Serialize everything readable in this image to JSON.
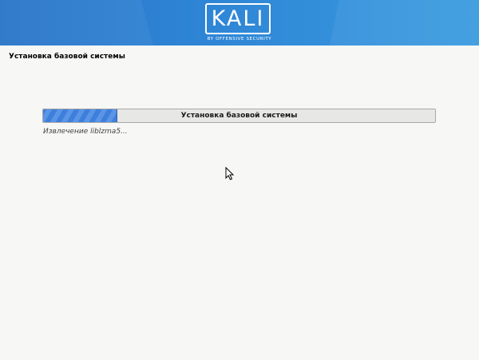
{
  "banner": {
    "logo_text": "KALI",
    "tagline": "BY OFFENSIVE SECURITY",
    "colors": {
      "gradient_start": "#2874c8",
      "gradient_end": "#3a9be0"
    }
  },
  "page": {
    "title": "Установка базовой системы"
  },
  "progress": {
    "label": "Установка базовой системы",
    "fraction": 0.19,
    "fill_color": "#3e7fdc"
  },
  "status": {
    "text": "Извлечение liblzma5..."
  },
  "cursor": {
    "icon": "mouse-pointer-icon"
  }
}
